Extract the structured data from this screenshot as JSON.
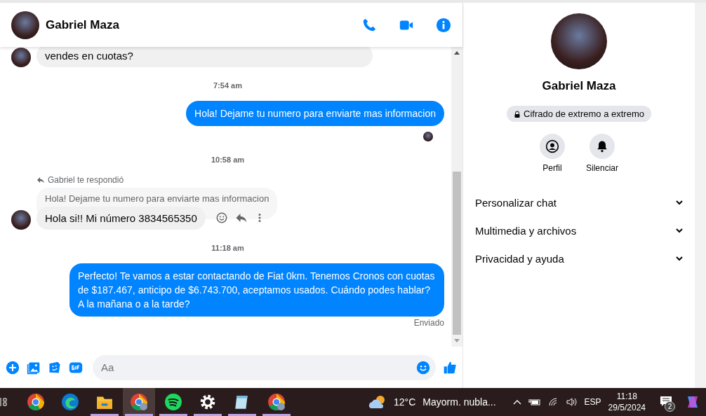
{
  "chat_header": {
    "name": "Gabriel Maza"
  },
  "messages": [
    {
      "kind": "incoming",
      "text": "vendes en cuotas?"
    },
    {
      "kind": "time",
      "text": "7:54 am"
    },
    {
      "kind": "outgoing",
      "text": "Hola! Dejame tu numero para enviarte mas informacion",
      "seen": true
    },
    {
      "kind": "time",
      "text": "10:58 am"
    },
    {
      "kind": "reply",
      "reply_label": "Gabriel te respondió",
      "quoted": "Hola! Dejame tu numero para enviarte mas informacion",
      "text": "Hola si!! Mi número 3834565350"
    },
    {
      "kind": "time",
      "text": "11:18 am"
    },
    {
      "kind": "outgoing",
      "text": "Perfecto! Te vamos a estar contactando de Fiat 0km. Tenemos Cronos con cuotas de $187.467, anticipo de $6.743.700, aceptamos usados. Cuándo podes hablar? A la mañana o a la tarde?",
      "status": "Enviado"
    }
  ],
  "composer": {
    "placeholder": "Aa"
  },
  "profile": {
    "name": "Gabriel Maza",
    "encryption": "Cifrado de extremo a extremo",
    "actions": [
      "Perfil",
      "Silenciar"
    ],
    "sections": [
      {
        "label": "Personalizar chat",
        "expanded": false
      },
      {
        "label": "Multimedia y archivos",
        "expanded": false
      },
      {
        "label": "Privacidad y ayuda",
        "expanded": false
      }
    ]
  },
  "taskbar": {
    "apps": [
      {
        "kind": "chrome",
        "running": false,
        "selected": false
      },
      {
        "kind": "edge",
        "running": false,
        "selected": false
      },
      {
        "kind": "folder",
        "running": true,
        "selected": false
      },
      {
        "kind": "chrome-profile",
        "running": true,
        "selected": true
      },
      {
        "kind": "spotify",
        "running": true,
        "selected": false
      },
      {
        "kind": "settings",
        "running": true,
        "selected": false
      },
      {
        "kind": "notepad",
        "running": true,
        "selected": false
      },
      {
        "kind": "chrome-profile",
        "running": true,
        "selected": false
      }
    ],
    "weather": {
      "temp": "12°C",
      "desc": "Mayorm. nubla..."
    },
    "language": "ESP",
    "time": "11:18",
    "date": "29/5/2024",
    "notifications": "2"
  }
}
